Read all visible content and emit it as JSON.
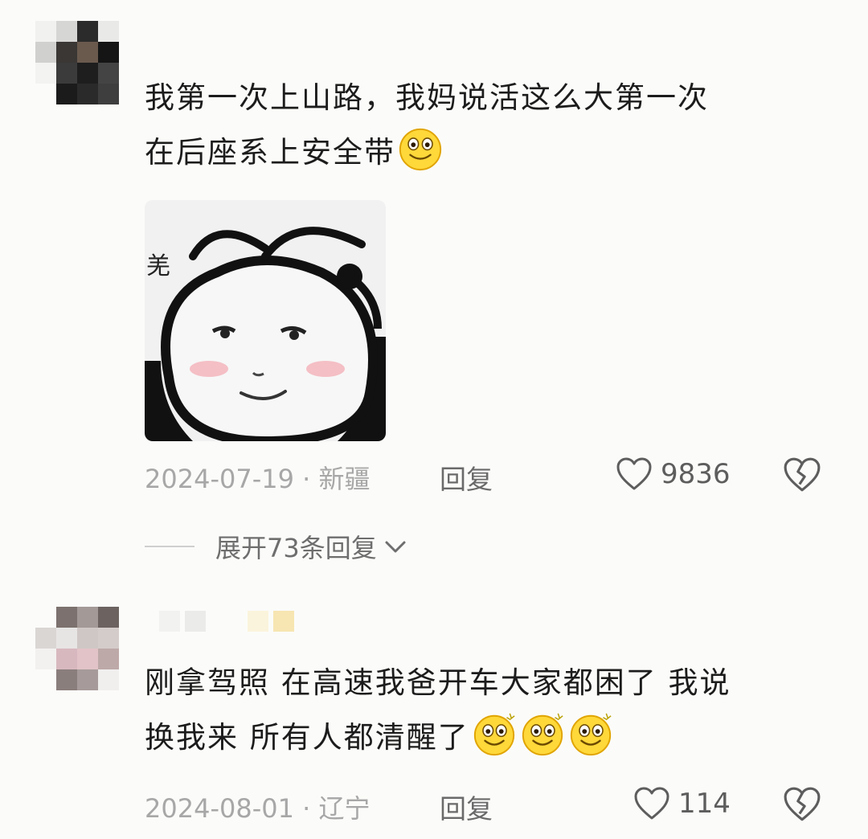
{
  "comments": [
    {
      "text_line1": "我第一次上山路，我妈说活这么大第一次",
      "text_line2": "在后座系上安全带",
      "emoji_count": 1,
      "sticker_text": "羌",
      "date": "2024-07-19",
      "location": "· 新疆",
      "reply_label": "回复",
      "likes": "9836",
      "expand_label": "展开73条回复"
    },
    {
      "text_line1": "刚拿驾照 在高速我爸开车大家都困了 我说",
      "text_line2": "换我来 所有人都清醒了",
      "emoji_count": 3,
      "date": "2024-08-01",
      "location": "· 辽宁",
      "reply_label": "回复",
      "likes": "114"
    }
  ],
  "icons": {
    "like": "heart-outline-icon",
    "dislike": "broken-heart-icon",
    "expand": "chevron-down-icon",
    "emoji": "smiling-face-icon"
  },
  "colors": {
    "background": "#fbfbf9",
    "text": "#1c1c1c",
    "meta": "#a7a7a7",
    "action": "#6a6a6a"
  }
}
